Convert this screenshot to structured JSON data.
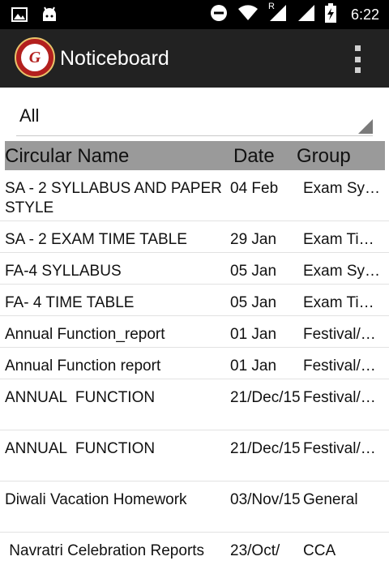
{
  "status_bar": {
    "time": "6:22",
    "left_icons": [
      "image-icon",
      "android-icon"
    ],
    "right_icons": [
      "do-not-disturb-icon",
      "wifi-icon",
      "signal-roaming-icon",
      "signal-icon",
      "battery-charging-icon"
    ],
    "roaming_label": "R"
  },
  "app_bar": {
    "title": "Noticeboard",
    "logo_letter": "G"
  },
  "filter": {
    "selected": "All"
  },
  "table": {
    "headers": {
      "name": "Circular Name",
      "date": "Date",
      "group": "Group"
    },
    "rows": [
      {
        "name": "SA - 2 SYLLABUS AND PAPER STYLE",
        "date": "04 Feb",
        "group": "Exam Syll…"
      },
      {
        "name": "SA - 2 EXAM TIME TABLE",
        "date": "29 Jan",
        "group": "Exam Ti…"
      },
      {
        "name": "FA-4 SYLLABUS",
        "date": "05 Jan",
        "group": "Exam Syll…"
      },
      {
        "name": "FA- 4 TIME TABLE",
        "date": "05 Jan",
        "group": "Exam Ti…"
      },
      {
        "name": "Annual Function_report",
        "date": "01 Jan",
        "group": "Festival/…"
      },
      {
        "name": "Annual Function report",
        "date": "01 Jan",
        "group": "Festival/…"
      },
      {
        "name": "ANNUAL  FUNCTION",
        "date": "21/Dec/15",
        "group": "Festival/…"
      },
      {
        "name": "ANNUAL  FUNCTION",
        "date": "21/Dec/15",
        "group": "Festival/…"
      },
      {
        "name": "Diwali Vacation Homework",
        "date": "03/Nov/15",
        "group": "General"
      },
      {
        "name": " Navratri Celebration Reports",
        "date": "23/Oct/",
        "group": "CCA"
      }
    ]
  }
}
